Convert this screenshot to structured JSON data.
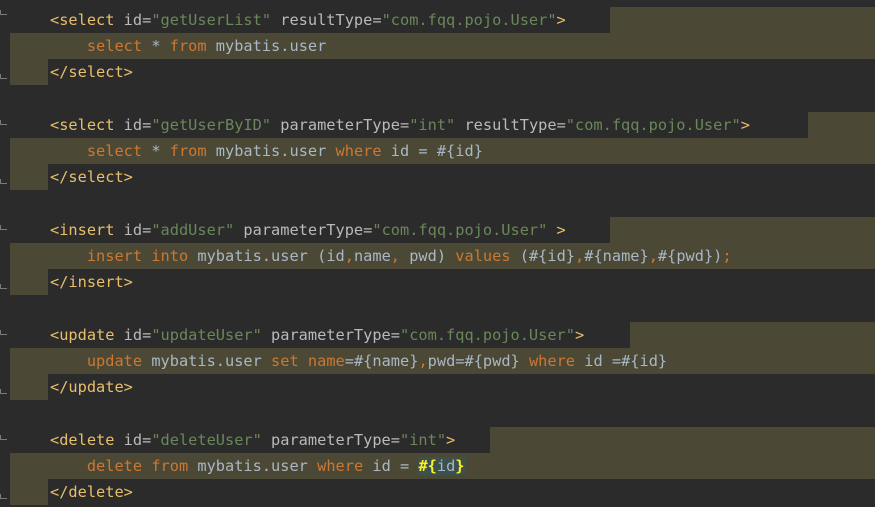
{
  "colors": {
    "background": "#2b2b2b",
    "block_highlight": "#4b4935",
    "tag": "#e8bf6a",
    "attribute": "#bababa",
    "string": "#6a8759",
    "keyword": "#cc7832",
    "text": "#a9b7c6",
    "brace_match": "#ffef28"
  },
  "code": {
    "l1": {
      "open": "<select",
      "a1": " id=",
      "v1": "\"getUserList\"",
      "a2": " resultType=",
      "v2": "\"com.fqq.pojo.User\"",
      "close": ">"
    },
    "l2": {
      "indent": "    ",
      "k1": "select",
      "t1": " * ",
      "k2": "from",
      "t2": " mybatis.user"
    },
    "l3": {
      "close": "</select>"
    },
    "l4": {
      "open": "<select",
      "a1": " id=",
      "v1": "\"getUserByID\"",
      "a2": " parameterType=",
      "v2": "\"int\"",
      "a3": " resultType=",
      "v3": "\"com.fqq.pojo.User\"",
      "close": ">"
    },
    "l5": {
      "indent": "    ",
      "k1": "select",
      "t1": " * ",
      "k2": "from",
      "t2": " mybatis.user ",
      "k3": "where",
      "t3": " id = #{id}"
    },
    "l6": {
      "close": "</select>"
    },
    "l7": {
      "open": "<insert",
      "a1": " id=",
      "v1": "\"addUser\"",
      "a2": " parameterType=",
      "v2": "\"com.fqq.pojo.User\"",
      "close": " >"
    },
    "l8": {
      "indent": "    ",
      "k1": "insert",
      "t1": " ",
      "k2": "into",
      "t2": " mybatis.user (id",
      "c1": ",",
      "t3": "name",
      "c2": ",",
      "t4": " pwd) ",
      "k3": "values",
      "t5": " (#{id}",
      "c3": ",",
      "t6": "#{name}",
      "c4": ",",
      "t7": "#{pwd})",
      "c5": ";"
    },
    "l9": {
      "close": "</insert>"
    },
    "l10": {
      "open": "<update",
      "a1": " id=",
      "v1": "\"updateUser\"",
      "a2": " parameterType=",
      "v2": "\"com.fqq.pojo.User\"",
      "close": ">"
    },
    "l11": {
      "indent": "    ",
      "k1": "update",
      "t1": " mybatis.user ",
      "k2": "set",
      "t2": " ",
      "k3": "name",
      "t3": "=#{name}",
      "c1": ",",
      "t4": "pwd=#{pwd} ",
      "k4": "where",
      "t5": " id =#{id}"
    },
    "l12": {
      "close": "</update>"
    },
    "l13": {
      "open": "<delete",
      "a1": " id=",
      "v1": "\"deleteUser\"",
      "a2": " parameterType=",
      "v2": "\"int\"",
      "close": ">"
    },
    "l14": {
      "indent": "    ",
      "k1": "delete",
      "t1": " ",
      "k2": "from",
      "t2": " mybatis.user ",
      "k3": "where",
      "t3": " id = ",
      "h1": "#{",
      "h2": "id",
      "h3": "}"
    },
    "l15": {
      "close": "</delete>"
    }
  }
}
